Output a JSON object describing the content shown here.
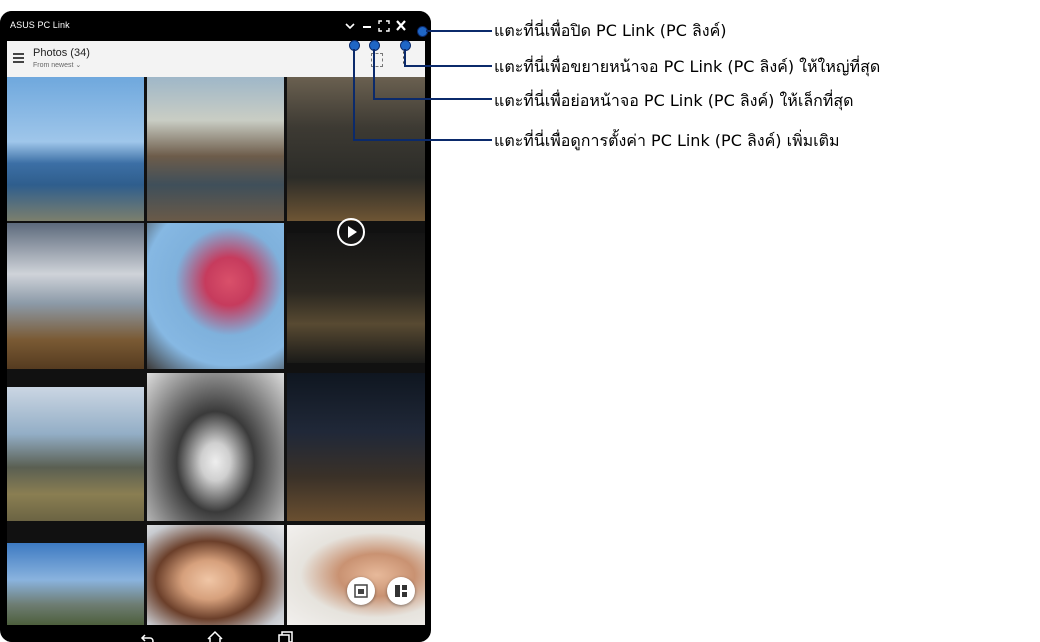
{
  "window": {
    "title": "ASUS PC Link"
  },
  "window_controls": {
    "settings_icon": "chevron-down",
    "minimize_icon": "minus",
    "maximize_icon": "expand",
    "close_icon": "close"
  },
  "appbar": {
    "title": "Photos (34)",
    "sort_label": "From newest"
  },
  "callouts": {
    "close": "แตะที่นี่เพื่อปิด PC Link (PC ลิงค์)",
    "maximize": "แตะที่นี่เพื่อขยายหน้าจอ PC Link (PC ลิงค์) ให้ใหญ่ที่สุด",
    "minimize": "แตะที่นี่เพื่อย่อหน้าจอ PC Link (PC ลิงค์) ให้เล็กที่สุด",
    "settings": "แตะที่นี่เพื่อดูการตั้งค่า PC Link (PC ลิงค์) เพิ่มเติม"
  },
  "colors": {
    "callout_line": "#0b2a6b",
    "callout_dot": "#1f66c6"
  }
}
